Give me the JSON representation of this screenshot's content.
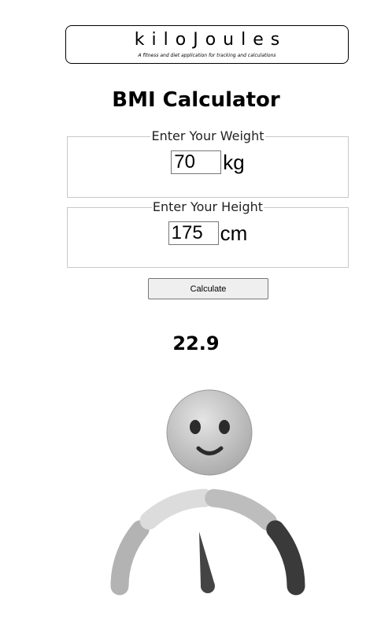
{
  "brand": {
    "name": "kiloJoules",
    "tagline": "A fitness and diet application for tracking and calculations"
  },
  "page": {
    "title": "BMI Calculator"
  },
  "weight": {
    "legend": "Enter Your Weight",
    "value": "70",
    "unit": "kg"
  },
  "height": {
    "legend": "Enter Your Height",
    "value": "175",
    "unit": "cm"
  },
  "calculate": {
    "label": "Calculate"
  },
  "result": {
    "bmi": "22.9"
  },
  "gauge": {
    "face_expression": "smile",
    "segment_colors": [
      "#b3b3b3",
      "#dcdcdc",
      "#bdbdbd",
      "#3a3a3a"
    ],
    "needle_color": "#444444",
    "needle_fraction": 0.45
  }
}
